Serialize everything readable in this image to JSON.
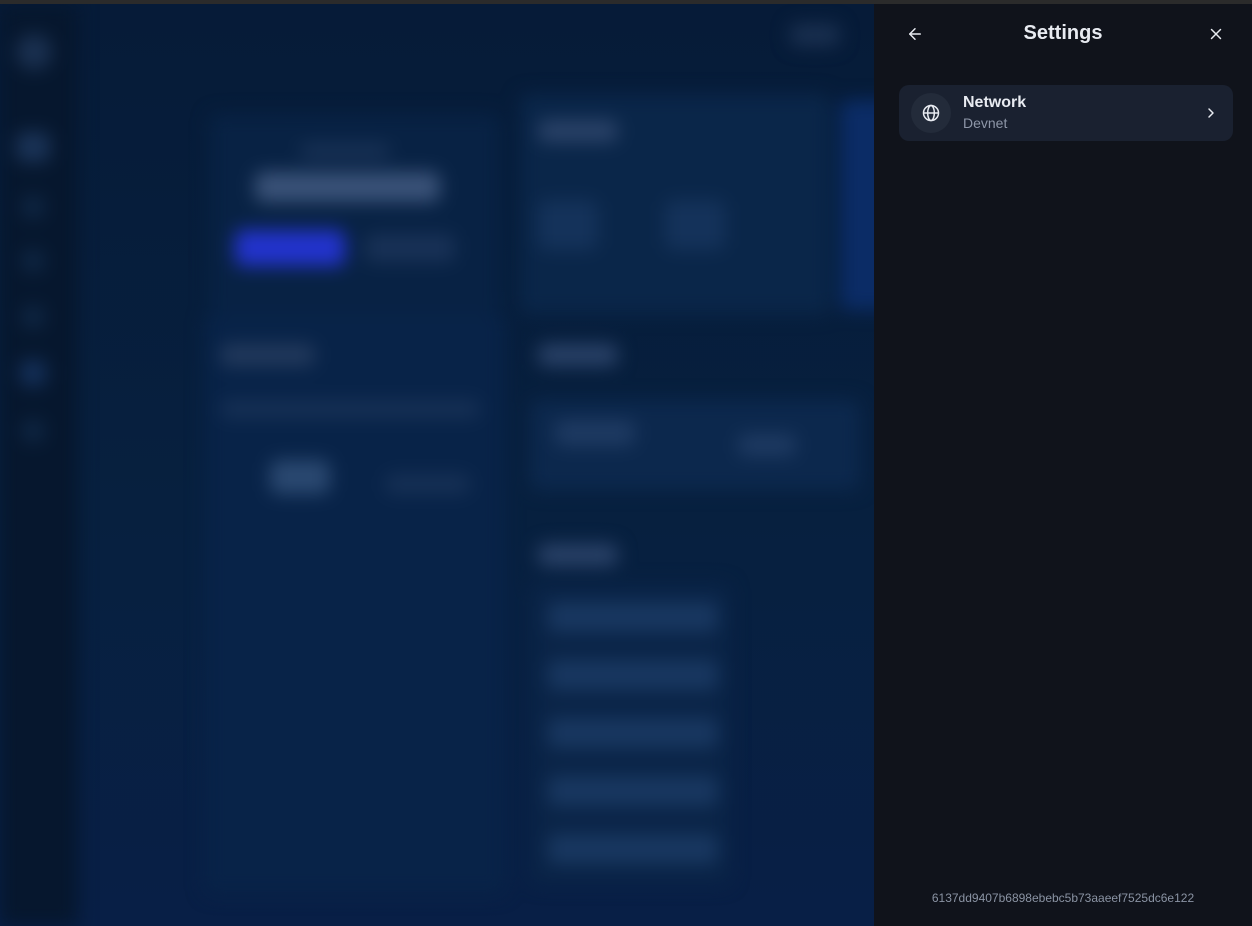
{
  "panel": {
    "title": "Settings",
    "back_icon": "arrow-left-icon",
    "close_icon": "close-icon",
    "items": [
      {
        "label": "Network",
        "value": "Devnet",
        "icon": "globe-icon"
      }
    ],
    "build_hash": "6137dd9407b6898ebebc5b73aaeef7525dc6e122"
  },
  "colors": {
    "panel_bg": "#10131b",
    "row_bg": "#1a2130",
    "backdrop": "#071a33",
    "accent_blur": "#2233cc"
  }
}
